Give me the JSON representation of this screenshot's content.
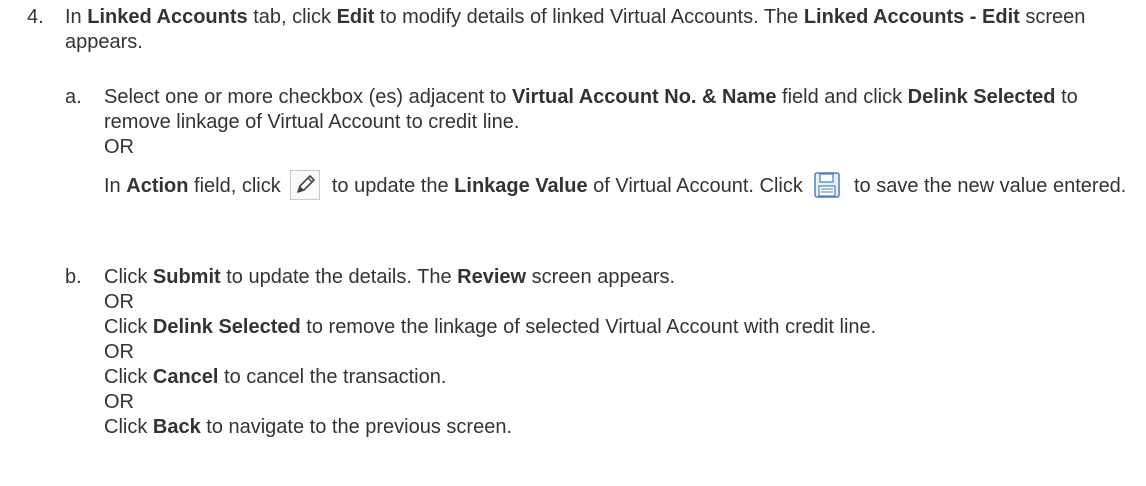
{
  "step": {
    "number": "4.",
    "t1": "In ",
    "b1": "Linked Accounts",
    "t2": " tab, click ",
    "b2": "Edit",
    "t3": " to modify details of linked Virtual Accounts. The ",
    "b3": "Linked Accounts - Edit",
    "t4": " screen appears."
  },
  "sub_a": {
    "letter": "a.",
    "t1": "Select one or more checkbox (es) adjacent to ",
    "b1": "Virtual Account No. & Name",
    "t2": " field and click ",
    "b2": "Delink Selected",
    "t3": " to remove linkage of Virtual Account to credit line.",
    "or": "OR",
    "t4": "In ",
    "b3": "Action",
    "t5": " field, click ",
    "t6": " to update the ",
    "b4": "Linkage Value",
    "t7": " of Virtual Account. Click ",
    "t8": " to save the new value entered."
  },
  "sub_b": {
    "letter": "b.",
    "l1_t1": "Click ",
    "l1_b1": "Submit",
    "l1_t2": " to update the details. The ",
    "l1_b2": "Review",
    "l1_t3": " screen appears.",
    "or1": "OR",
    "l2_t1": "Click ",
    "l2_b1": "Delink Selected",
    "l2_t2": " to remove the linkage of selected Virtual Account with credit line.",
    "or2": "OR",
    "l3_t1": "Click ",
    "l3_b1": "Cancel",
    "l3_t2": " to cancel the transaction.",
    "or3": "OR",
    "l4_t1": "Click ",
    "l4_b1": "Back",
    "l4_t2": " to navigate to the previous screen."
  },
  "icons": {
    "edit": "pencil-icon",
    "save": "floppy-disk-icon"
  }
}
